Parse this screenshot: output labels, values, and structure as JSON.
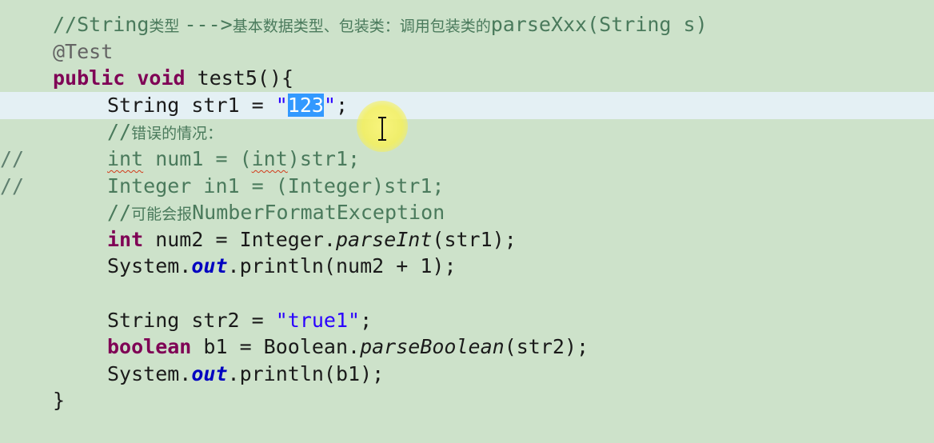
{
  "editor": {
    "current_line_index": 3,
    "colors": {
      "background": "#cde2ca",
      "current_line": "#e4f0f4",
      "keyword": "#7f0055",
      "string": "#2a00ff",
      "comment": "#4a7a5c",
      "selection": "#3399ff",
      "static_field": "#0000c0",
      "annotation": "#646464",
      "cursor_highlight": "#f5f05a"
    },
    "lines": [
      {
        "marker": "",
        "indent": 1,
        "tokens": [
          {
            "t": "//String",
            "c": "cm"
          },
          {
            "t": "类型 ",
            "c": "cm zh"
          },
          {
            "t": "--->",
            "c": "cm"
          },
          {
            "t": "基本数据类型、包装类：调用包装类的",
            "c": "cm zh"
          },
          {
            "t": "parseXxx(String s)",
            "c": "cm"
          }
        ]
      },
      {
        "marker": "",
        "indent": 1,
        "tokens": [
          {
            "t": "@Test",
            "c": "ann"
          }
        ]
      },
      {
        "marker": "",
        "indent": 1,
        "tokens": [
          {
            "t": "public",
            "c": "kw"
          },
          {
            "t": " ",
            "c": ""
          },
          {
            "t": "void",
            "c": "kw"
          },
          {
            "t": " test5(){",
            "c": ""
          }
        ]
      },
      {
        "marker": "",
        "indent": 2,
        "tokens": [
          {
            "t": "String str1 = ",
            "c": ""
          },
          {
            "t": "\"",
            "c": "str"
          },
          {
            "t": "123",
            "c": "str sel"
          },
          {
            "t": "\"",
            "c": "str"
          },
          {
            "t": ";",
            "c": ""
          }
        ]
      },
      {
        "marker": "",
        "indent": 2,
        "tokens": [
          {
            "t": "//",
            "c": "cm"
          },
          {
            "t": "错误的情况：",
            "c": "cm zh"
          }
        ]
      },
      {
        "marker": "//",
        "indent": 2,
        "tokens": [
          {
            "t": "int",
            "c": "cm squiggle"
          },
          {
            "t": " num1 = (",
            "c": "cm"
          },
          {
            "t": "int",
            "c": "cm squiggle"
          },
          {
            "t": ")str1;",
            "c": "cm"
          }
        ]
      },
      {
        "marker": "//",
        "indent": 2,
        "tokens": [
          {
            "t": "Integer in1 = (Integer)str1;",
            "c": "cm"
          }
        ]
      },
      {
        "marker": "",
        "indent": 2,
        "tokens": [
          {
            "t": "//",
            "c": "cm"
          },
          {
            "t": "可能会报",
            "c": "cm zh"
          },
          {
            "t": "NumberFormatException",
            "c": "cm"
          }
        ]
      },
      {
        "marker": "",
        "indent": 2,
        "tokens": [
          {
            "t": "int",
            "c": "kw"
          },
          {
            "t": " num2 = Integer.",
            "c": ""
          },
          {
            "t": "parseInt",
            "c": "static"
          },
          {
            "t": "(str1);",
            "c": ""
          }
        ]
      },
      {
        "marker": "",
        "indent": 2,
        "tokens": [
          {
            "t": "System.",
            "c": ""
          },
          {
            "t": "out",
            "c": "field"
          },
          {
            "t": ".println(num2 + 1);",
            "c": ""
          }
        ]
      },
      {
        "marker": "",
        "indent": 2,
        "tokens": []
      },
      {
        "marker": "",
        "indent": 2,
        "tokens": [
          {
            "t": "String str2 = ",
            "c": ""
          },
          {
            "t": "\"true1\"",
            "c": "str"
          },
          {
            "t": ";",
            "c": ""
          }
        ]
      },
      {
        "marker": "",
        "indent": 2,
        "tokens": [
          {
            "t": "boolean",
            "c": "kw"
          },
          {
            "t": " b1 = Boolean.",
            "c": ""
          },
          {
            "t": "parseBoolean",
            "c": "static"
          },
          {
            "t": "(str2);",
            "c": ""
          }
        ]
      },
      {
        "marker": "",
        "indent": 2,
        "tokens": [
          {
            "t": "System.",
            "c": ""
          },
          {
            "t": "out",
            "c": "field"
          },
          {
            "t": ".println(b1);",
            "c": ""
          }
        ]
      },
      {
        "marker": "",
        "indent": 1,
        "tokens": [
          {
            "t": "}",
            "c": ""
          }
        ]
      }
    ]
  },
  "pointer": {
    "icon": "ibeam-cursor-icon",
    "highlight": "cursor-highlight"
  }
}
